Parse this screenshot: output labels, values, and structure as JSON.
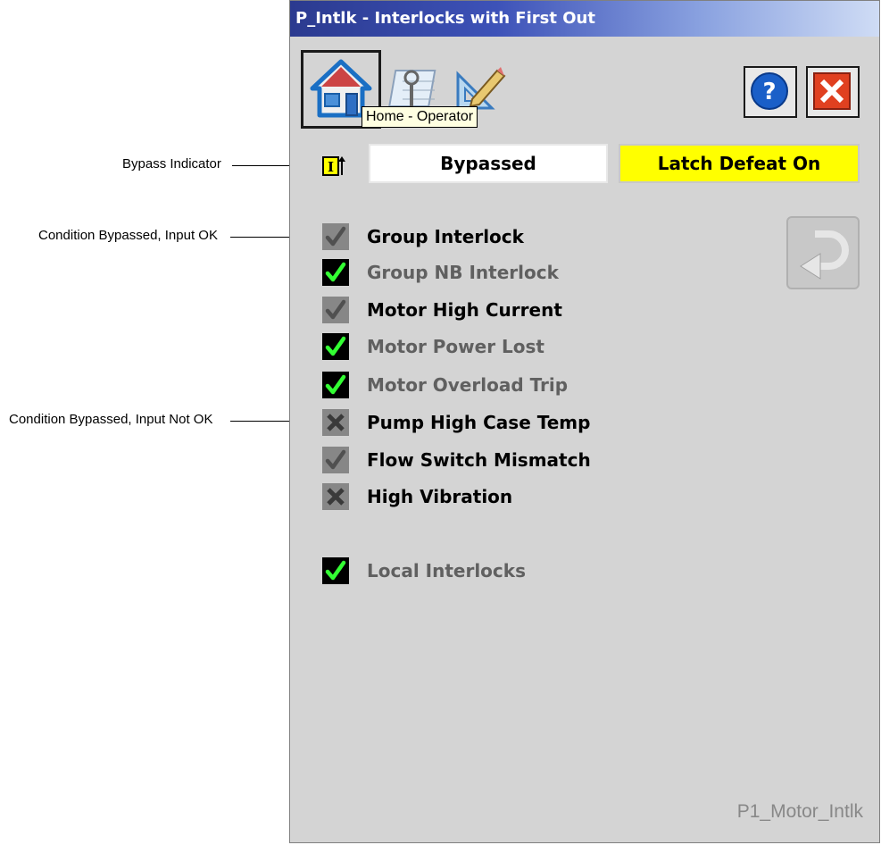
{
  "callouts": {
    "bypass_indicator": "Bypass Indicator",
    "condition_bypassed_ok": "Condition Bypassed, Input OK",
    "condition_bypassed_not_ok": "Condition Bypassed, Input Not OK"
  },
  "window": {
    "title": "P_Intlk - Interlocks with First Out",
    "tabs": [
      {
        "name": "home",
        "icon": "house-icon",
        "selected": true
      },
      {
        "name": "maintenance",
        "icon": "wrench-calendar-icon",
        "selected": false
      },
      {
        "name": "engineering",
        "icon": "triangle-pencil-icon",
        "selected": false
      }
    ],
    "tooltip": "Home - Operator",
    "tag_name": "P1_Motor_Intlk"
  },
  "status": {
    "bypassed": "Bypassed",
    "latch_defeat": "Latch Defeat On",
    "bypass_indicator_glyph": "I"
  },
  "interlocks": [
    {
      "label": "Group Interlock",
      "state": "bypass-ok"
    },
    {
      "label": "Group NB Interlock",
      "state": "ok"
    },
    {
      "label": "Motor High Current",
      "state": "bypass-ok"
    },
    {
      "label": "Motor Power Lost",
      "state": "ok"
    },
    {
      "label": "Motor Overload Trip",
      "state": "ok"
    },
    {
      "label": "Pump High Case Temp",
      "state": "bypass-not-ok"
    },
    {
      "label": "Flow Switch Mismatch",
      "state": "bypass-ok"
    },
    {
      "label": "High Vibration",
      "state": "bypass-not-ok"
    }
  ],
  "local_interlocks": {
    "label": "Local Interlocks",
    "state": "ok"
  },
  "colors": {
    "ok_check": "#33ff33",
    "bypass_bg": "#878787",
    "latch_bg": "#ffff00",
    "title_bar_start": "#2b3a8f"
  }
}
